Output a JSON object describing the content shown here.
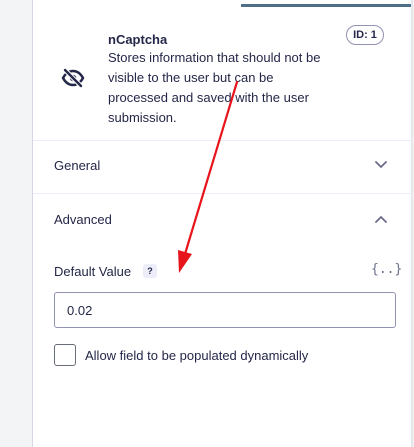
{
  "field": {
    "name": "nCaptcha",
    "description": "Stores information that should not be visible to the user but can be processed and saved with the user submission.",
    "id_badge": "ID: 1",
    "icon": "eye-slash-icon"
  },
  "sections": {
    "general": {
      "label": "General",
      "expanded": false,
      "icon": "chevron-down-icon"
    },
    "advanced": {
      "label": "Advanced",
      "expanded": true,
      "icon": "chevron-up-icon"
    }
  },
  "default_value": {
    "label": "Default Value",
    "help": "?",
    "merge_tag_icon": "{..}",
    "value": "0.02"
  },
  "dynamic_population": {
    "label": "Allow field to be populated dynamically",
    "checked": false
  },
  "colors": {
    "accent": "#4f6f86",
    "text": "#242748",
    "border": "#9092b2",
    "annotation_arrow": "#e8141b"
  }
}
